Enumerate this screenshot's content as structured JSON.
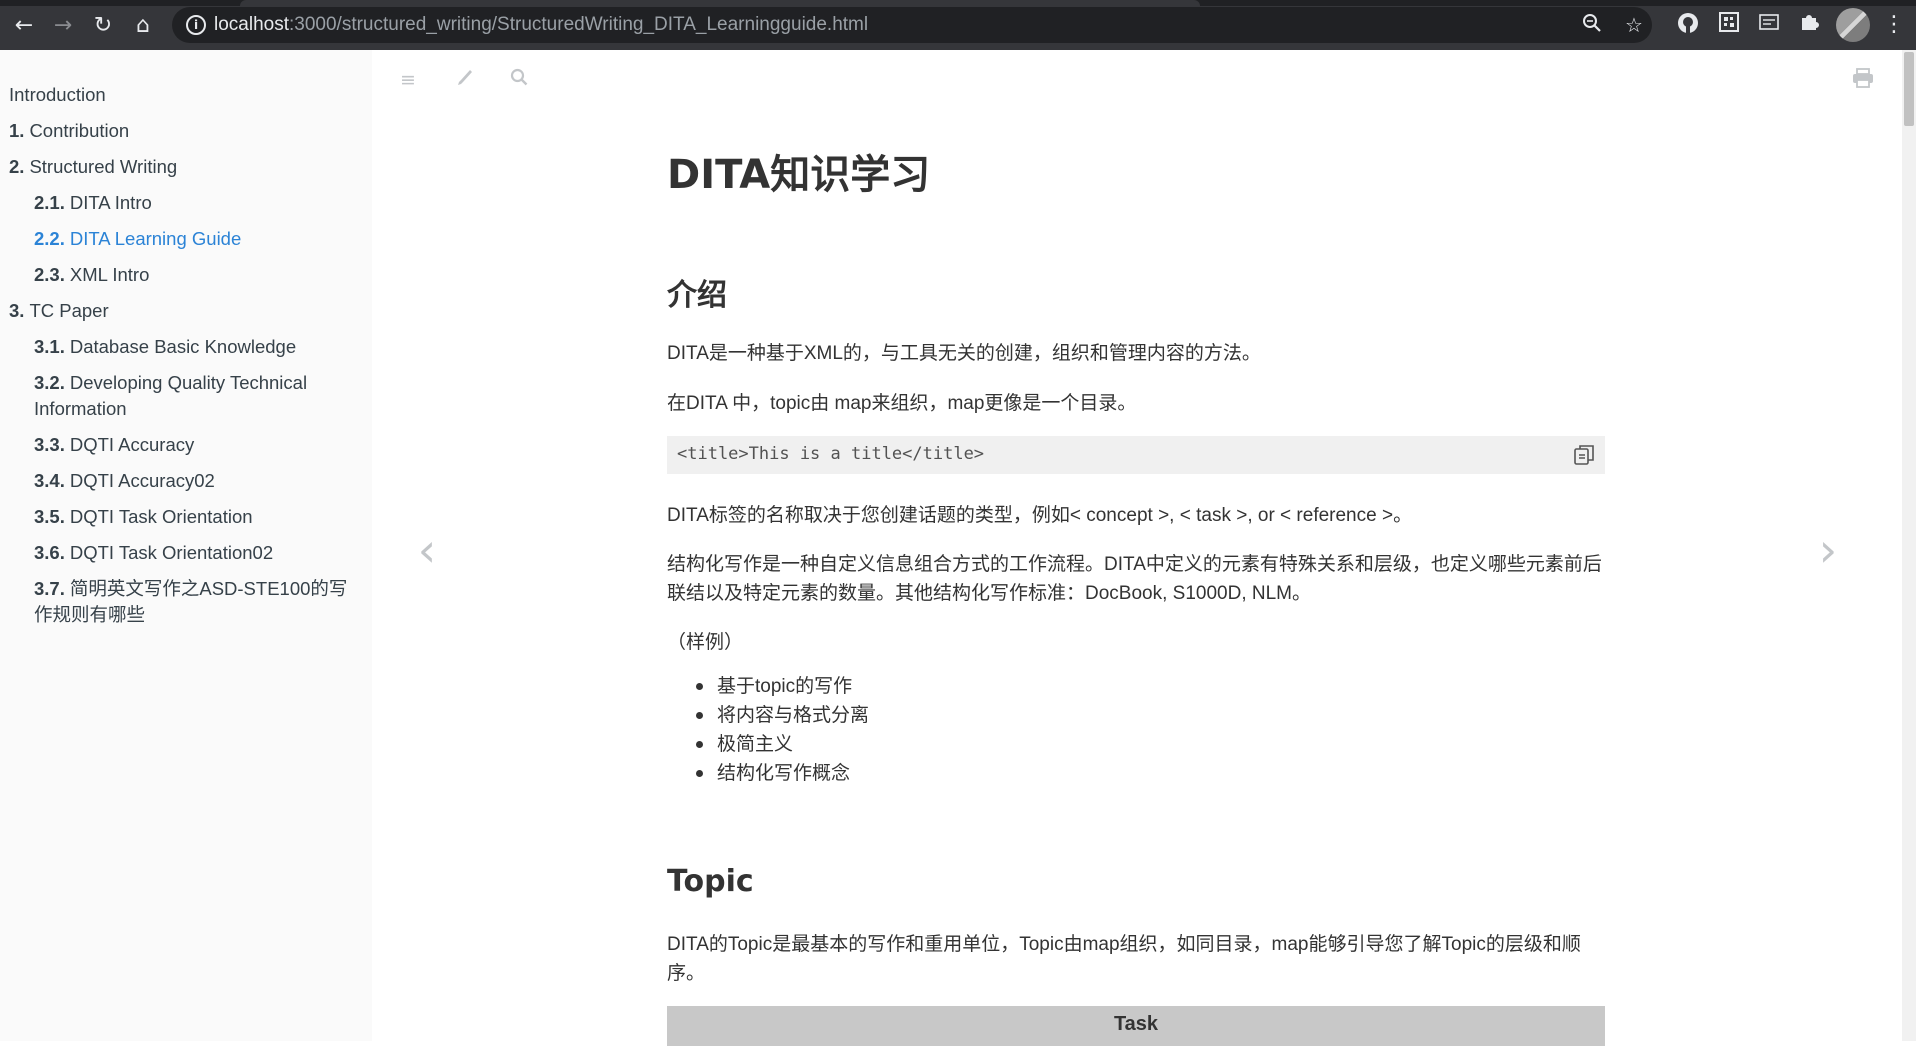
{
  "browser": {
    "url_host": "localhost",
    "url_path": ":3000/structured_writing/StructuredWriting_DITA_Learningguide.html",
    "nav": {
      "back": "←",
      "forward": "→",
      "reload": "↻",
      "home": "⌂"
    },
    "icons": [
      "zoom-icon",
      "star-icon",
      "github-icon",
      "qr-icon",
      "reader-icon",
      "puzzle-icon"
    ]
  },
  "sidebar": {
    "items": [
      {
        "num": "",
        "label": "Introduction",
        "level": 0,
        "active": false
      },
      {
        "num": "1.",
        "label": "Contribution",
        "level": 0,
        "active": false
      },
      {
        "num": "2.",
        "label": "Structured Writing",
        "level": 0,
        "active": false
      },
      {
        "num": "2.1.",
        "label": "DITA Intro",
        "level": 1,
        "active": false
      },
      {
        "num": "2.2.",
        "label": "DITA Learning Guide",
        "level": 1,
        "active": true
      },
      {
        "num": "2.3.",
        "label": "XML Intro",
        "level": 1,
        "active": false
      },
      {
        "num": "3.",
        "label": "TC Paper",
        "level": 0,
        "active": false
      },
      {
        "num": "3.1.",
        "label": "Database Basic Knowledge",
        "level": 1,
        "active": false
      },
      {
        "num": "3.2.",
        "label": "Developing Quality Technical Information",
        "level": 1,
        "active": false
      },
      {
        "num": "3.3.",
        "label": "DQTI Accuracy",
        "level": 1,
        "active": false
      },
      {
        "num": "3.4.",
        "label": "DQTI Accuracy02",
        "level": 1,
        "active": false
      },
      {
        "num": "3.5.",
        "label": "DQTI Task Orientation",
        "level": 1,
        "active": false
      },
      {
        "num": "3.6.",
        "label": "DQTI Task Orientation02",
        "level": 1,
        "active": false
      },
      {
        "num": "3.7.",
        "label": "简明英文写作之ASD-STE100的写作规则有哪些",
        "level": 1,
        "active": false
      }
    ]
  },
  "page": {
    "title": "DITA知识学习",
    "h_intro": "介绍",
    "p1": "DITA是一种基于XML的，与工具无关的创建，组织和管理内容的方法。",
    "p2": "在DITA 中，topic由 map来组织，map更像是一个目录。",
    "code": "<title>This is a title</title>",
    "p3": "DITA标签的名称取决于您创建话题的类型，例如< concept >, < task >, or < reference >。",
    "p4": "结构化写作是一种自定义信息组合方式的工作流程。DITA中定义的元素有特殊关系和层级，也定义哪些元素前后联结以及特定元素的数量。其他结构化写作标准：DocBook, S1000D, NLM。",
    "p5": "（样例）",
    "bullets": [
      "基于topic的写作",
      "将内容与格式分离",
      "极简主义",
      "结构化写作概念"
    ],
    "h_topic": "Topic",
    "p6": "DITA的Topic是最基本的写作和重用单位，Topic由map组织，如同目录，map能够引导您了解Topic的层级和顺序。",
    "table_header": "Task"
  },
  "colors": {
    "active_link": "#2b83d6",
    "sidebar_bg": "#fafafa",
    "chrome_bg": "#35363a"
  }
}
